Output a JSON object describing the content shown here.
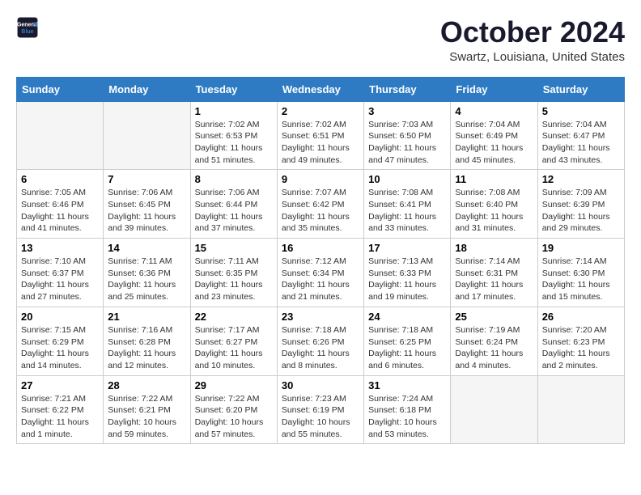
{
  "header": {
    "logo_line1": "General",
    "logo_line2": "Blue",
    "month": "October 2024",
    "location": "Swartz, Louisiana, United States"
  },
  "days_of_week": [
    "Sunday",
    "Monday",
    "Tuesday",
    "Wednesday",
    "Thursday",
    "Friday",
    "Saturday"
  ],
  "weeks": [
    [
      {
        "day": "",
        "info": ""
      },
      {
        "day": "",
        "info": ""
      },
      {
        "day": "1",
        "info": "Sunrise: 7:02 AM\nSunset: 6:53 PM\nDaylight: 11 hours and 51 minutes."
      },
      {
        "day": "2",
        "info": "Sunrise: 7:02 AM\nSunset: 6:51 PM\nDaylight: 11 hours and 49 minutes."
      },
      {
        "day": "3",
        "info": "Sunrise: 7:03 AM\nSunset: 6:50 PM\nDaylight: 11 hours and 47 minutes."
      },
      {
        "day": "4",
        "info": "Sunrise: 7:04 AM\nSunset: 6:49 PM\nDaylight: 11 hours and 45 minutes."
      },
      {
        "day": "5",
        "info": "Sunrise: 7:04 AM\nSunset: 6:47 PM\nDaylight: 11 hours and 43 minutes."
      }
    ],
    [
      {
        "day": "6",
        "info": "Sunrise: 7:05 AM\nSunset: 6:46 PM\nDaylight: 11 hours and 41 minutes."
      },
      {
        "day": "7",
        "info": "Sunrise: 7:06 AM\nSunset: 6:45 PM\nDaylight: 11 hours and 39 minutes."
      },
      {
        "day": "8",
        "info": "Sunrise: 7:06 AM\nSunset: 6:44 PM\nDaylight: 11 hours and 37 minutes."
      },
      {
        "day": "9",
        "info": "Sunrise: 7:07 AM\nSunset: 6:42 PM\nDaylight: 11 hours and 35 minutes."
      },
      {
        "day": "10",
        "info": "Sunrise: 7:08 AM\nSunset: 6:41 PM\nDaylight: 11 hours and 33 minutes."
      },
      {
        "day": "11",
        "info": "Sunrise: 7:08 AM\nSunset: 6:40 PM\nDaylight: 11 hours and 31 minutes."
      },
      {
        "day": "12",
        "info": "Sunrise: 7:09 AM\nSunset: 6:39 PM\nDaylight: 11 hours and 29 minutes."
      }
    ],
    [
      {
        "day": "13",
        "info": "Sunrise: 7:10 AM\nSunset: 6:37 PM\nDaylight: 11 hours and 27 minutes."
      },
      {
        "day": "14",
        "info": "Sunrise: 7:11 AM\nSunset: 6:36 PM\nDaylight: 11 hours and 25 minutes."
      },
      {
        "day": "15",
        "info": "Sunrise: 7:11 AM\nSunset: 6:35 PM\nDaylight: 11 hours and 23 minutes."
      },
      {
        "day": "16",
        "info": "Sunrise: 7:12 AM\nSunset: 6:34 PM\nDaylight: 11 hours and 21 minutes."
      },
      {
        "day": "17",
        "info": "Sunrise: 7:13 AM\nSunset: 6:33 PM\nDaylight: 11 hours and 19 minutes."
      },
      {
        "day": "18",
        "info": "Sunrise: 7:14 AM\nSunset: 6:31 PM\nDaylight: 11 hours and 17 minutes."
      },
      {
        "day": "19",
        "info": "Sunrise: 7:14 AM\nSunset: 6:30 PM\nDaylight: 11 hours and 15 minutes."
      }
    ],
    [
      {
        "day": "20",
        "info": "Sunrise: 7:15 AM\nSunset: 6:29 PM\nDaylight: 11 hours and 14 minutes."
      },
      {
        "day": "21",
        "info": "Sunrise: 7:16 AM\nSunset: 6:28 PM\nDaylight: 11 hours and 12 minutes."
      },
      {
        "day": "22",
        "info": "Sunrise: 7:17 AM\nSunset: 6:27 PM\nDaylight: 11 hours and 10 minutes."
      },
      {
        "day": "23",
        "info": "Sunrise: 7:18 AM\nSunset: 6:26 PM\nDaylight: 11 hours and 8 minutes."
      },
      {
        "day": "24",
        "info": "Sunrise: 7:18 AM\nSunset: 6:25 PM\nDaylight: 11 hours and 6 minutes."
      },
      {
        "day": "25",
        "info": "Sunrise: 7:19 AM\nSunset: 6:24 PM\nDaylight: 11 hours and 4 minutes."
      },
      {
        "day": "26",
        "info": "Sunrise: 7:20 AM\nSunset: 6:23 PM\nDaylight: 11 hours and 2 minutes."
      }
    ],
    [
      {
        "day": "27",
        "info": "Sunrise: 7:21 AM\nSunset: 6:22 PM\nDaylight: 11 hours and 1 minute."
      },
      {
        "day": "28",
        "info": "Sunrise: 7:22 AM\nSunset: 6:21 PM\nDaylight: 10 hours and 59 minutes."
      },
      {
        "day": "29",
        "info": "Sunrise: 7:22 AM\nSunset: 6:20 PM\nDaylight: 10 hours and 57 minutes."
      },
      {
        "day": "30",
        "info": "Sunrise: 7:23 AM\nSunset: 6:19 PM\nDaylight: 10 hours and 55 minutes."
      },
      {
        "day": "31",
        "info": "Sunrise: 7:24 AM\nSunset: 6:18 PM\nDaylight: 10 hours and 53 minutes."
      },
      {
        "day": "",
        "info": ""
      },
      {
        "day": "",
        "info": ""
      }
    ]
  ]
}
